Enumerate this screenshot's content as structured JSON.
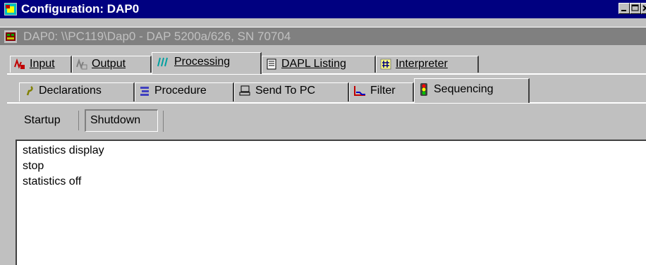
{
  "window": {
    "title": "Configuration: DAP0",
    "subtitle": "DAP0: \\\\PC119\\Dap0 - DAP 5200a/626, SN 70704"
  },
  "main_tabs": [
    {
      "label": "Input",
      "icon": "input-signal-icon"
    },
    {
      "label": "Output",
      "icon": "output-signal-icon"
    },
    {
      "label": "Processing",
      "icon": "processing-waves-icon",
      "active": true
    },
    {
      "label": "DAPL Listing",
      "icon": "listing-document-icon"
    },
    {
      "label": "Interpreter",
      "icon": "interpreter-grid-icon"
    }
  ],
  "processing_tabs": [
    {
      "label": "Declarations",
      "icon": "declarations-hook-icon"
    },
    {
      "label": "Procedure",
      "icon": "procedure-blocks-icon"
    },
    {
      "label": "Send To PC",
      "icon": "send-to-pc-icon"
    },
    {
      "label": "Filter",
      "icon": "filter-graph-icon"
    },
    {
      "label": "Sequencing",
      "icon": "traffic-light-icon",
      "active": true
    }
  ],
  "sequencing_tabs": [
    {
      "label": "Startup"
    },
    {
      "label": "Shutdown",
      "active": true
    }
  ],
  "content": {
    "lines": [
      "statistics display",
      "stop",
      "statistics off"
    ]
  },
  "colors": {
    "titlebar": "#000080",
    "face": "#c0c0c0",
    "subtitle_bar": "#808080"
  }
}
